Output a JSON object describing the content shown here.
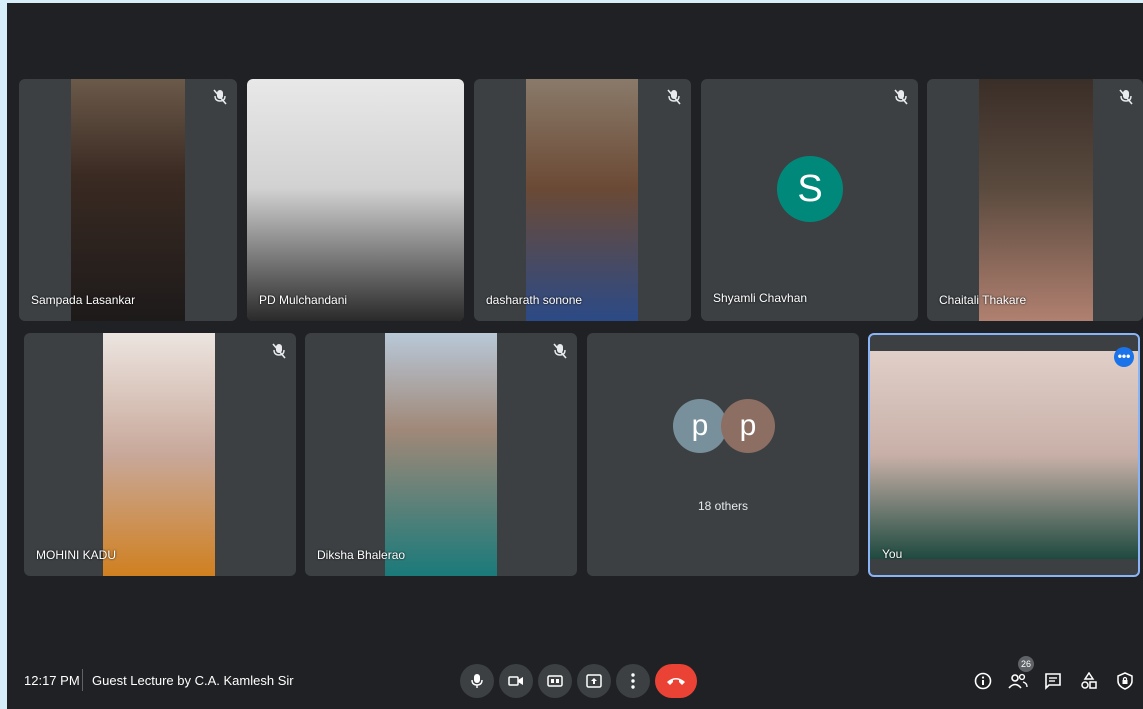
{
  "participants": [
    {
      "name": "Sampada Lasankar",
      "muted": true
    },
    {
      "name": "PD Mulchandani",
      "muted": false
    },
    {
      "name": "dasharath sonone",
      "muted": true
    },
    {
      "name": "Shyamli Chavhan",
      "muted": true,
      "avatar_letter": "S",
      "avatar_color": "#00897b"
    },
    {
      "name": "Chaitali Thakare",
      "muted": true
    },
    {
      "name": "MOHINI KADU",
      "muted": true
    },
    {
      "name": "Diksha Bhalerao",
      "muted": true
    }
  ],
  "others_tile": {
    "avatars": [
      {
        "letter": "p",
        "color": "#78909c"
      },
      {
        "letter": "p",
        "color": "#8d6e63"
      }
    ],
    "label": "18 others"
  },
  "self_tile": {
    "name": "You",
    "more_label": "•••"
  },
  "bottom_bar": {
    "time": "12:17 PM",
    "meeting_title": "Guest Lecture by C.A. Kamlesh Sir",
    "people_count": "26"
  },
  "colors": {
    "background": "#202124",
    "tile": "#3c4043",
    "end_call": "#ea4335",
    "accent": "#8ab4f8"
  }
}
